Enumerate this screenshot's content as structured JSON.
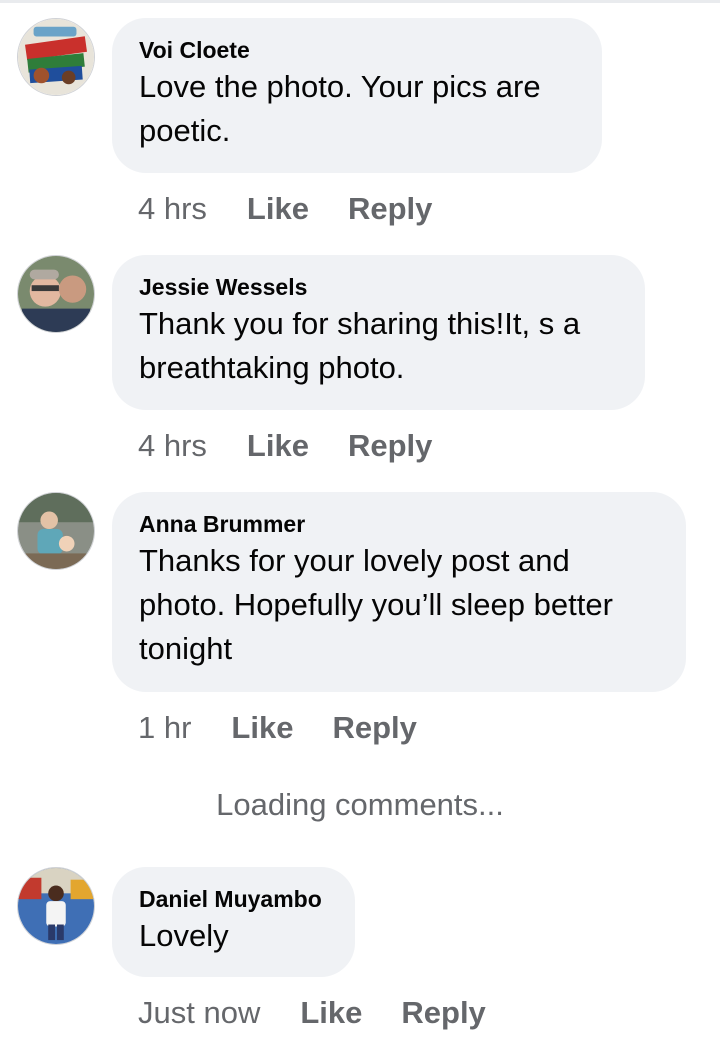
{
  "comments": [
    {
      "author": "Voi Cloete",
      "text": "Love the photo. Your pics are\npoetic.",
      "time": "4 hrs",
      "like_label": "Like",
      "reply_label": "Reply",
      "avatar_icon": "profile-picture-icon"
    },
    {
      "author": "Jessie Wessels",
      "text": "Thank you for sharing this!It, s a\nbreathtaking photo.",
      "time": "4 hrs",
      "like_label": "Like",
      "reply_label": "Reply",
      "avatar_icon": "profile-picture-icon"
    },
    {
      "author": "Anna Brummer",
      "text": "Thanks for your lovely post and\nphoto. Hopefully you’ll sleep better\ntonight",
      "time": "1 hr",
      "like_label": "Like",
      "reply_label": "Reply",
      "avatar_icon": "profile-picture-icon"
    },
    {
      "author": "Daniel Muyambo",
      "text": "Lovely",
      "time": "Just now",
      "like_label": "Like",
      "reply_label": "Reply",
      "avatar_icon": "profile-picture-icon"
    }
  ],
  "loading_label": "Loading comments...",
  "colors": {
    "bubble": "#f0f2f5",
    "meta_text": "#65676b",
    "primary_text": "#050505"
  }
}
